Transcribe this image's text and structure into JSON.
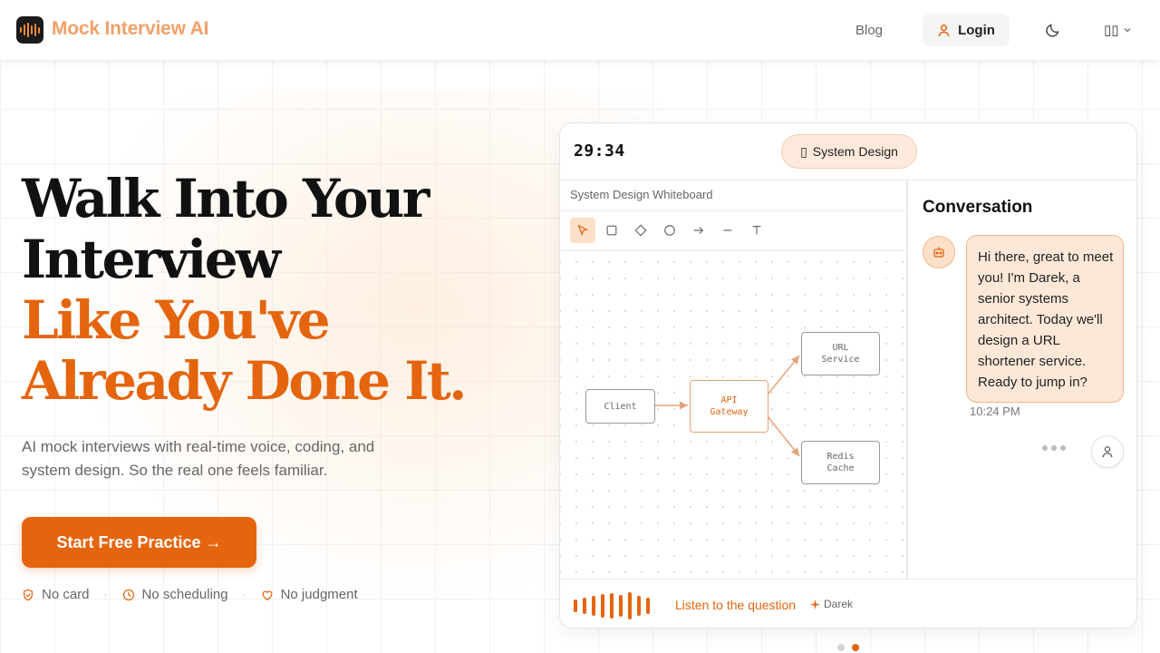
{
  "header": {
    "brand": "Mock Interview AI",
    "nav_blog": "Blog",
    "login_label": "Login",
    "theme_icon": "moon-icon",
    "language_label": "▯▯"
  },
  "hero": {
    "title_line1": "Walk Into Your",
    "title_line2": "Interview",
    "title_line3": "Like You've",
    "title_line4": "Already Done It.",
    "subtitle": "AI mock interviews with real-time voice, coding, and system design. So the real one feels familiar.",
    "cta_label": "Start Free Practice →",
    "perks": [
      "No card",
      "No scheduling",
      "No judgment"
    ]
  },
  "demo": {
    "timer": "29:34",
    "topic_icon": "▯",
    "topic": "System Design",
    "whiteboard_label": "System Design Whiteboard",
    "tools": [
      "select",
      "rectangle",
      "diamond",
      "circle",
      "arrow",
      "line",
      "text"
    ],
    "nodes": {
      "client": "Client",
      "gateway_line1": "API",
      "gateway_line2": "Gateway",
      "url_line1": "URL",
      "url_line2": "Service",
      "cache_line1": "Redis",
      "cache_line2": "Cache"
    },
    "conversation_title": "Conversation",
    "message": "Hi there, great to meet you! I'm Darek, a senior systems architect. Today we'll design a URL shortener service. Ready to jump in?",
    "message_time": "10:24 PM",
    "listen_label": "Listen to the question",
    "speaker_name": "Darek"
  },
  "colors": {
    "accent": "#e4650e",
    "accent_light": "#fde8d8",
    "brand_text": "#f2a068"
  },
  "pager": {
    "count": 2,
    "active_index": 1
  }
}
